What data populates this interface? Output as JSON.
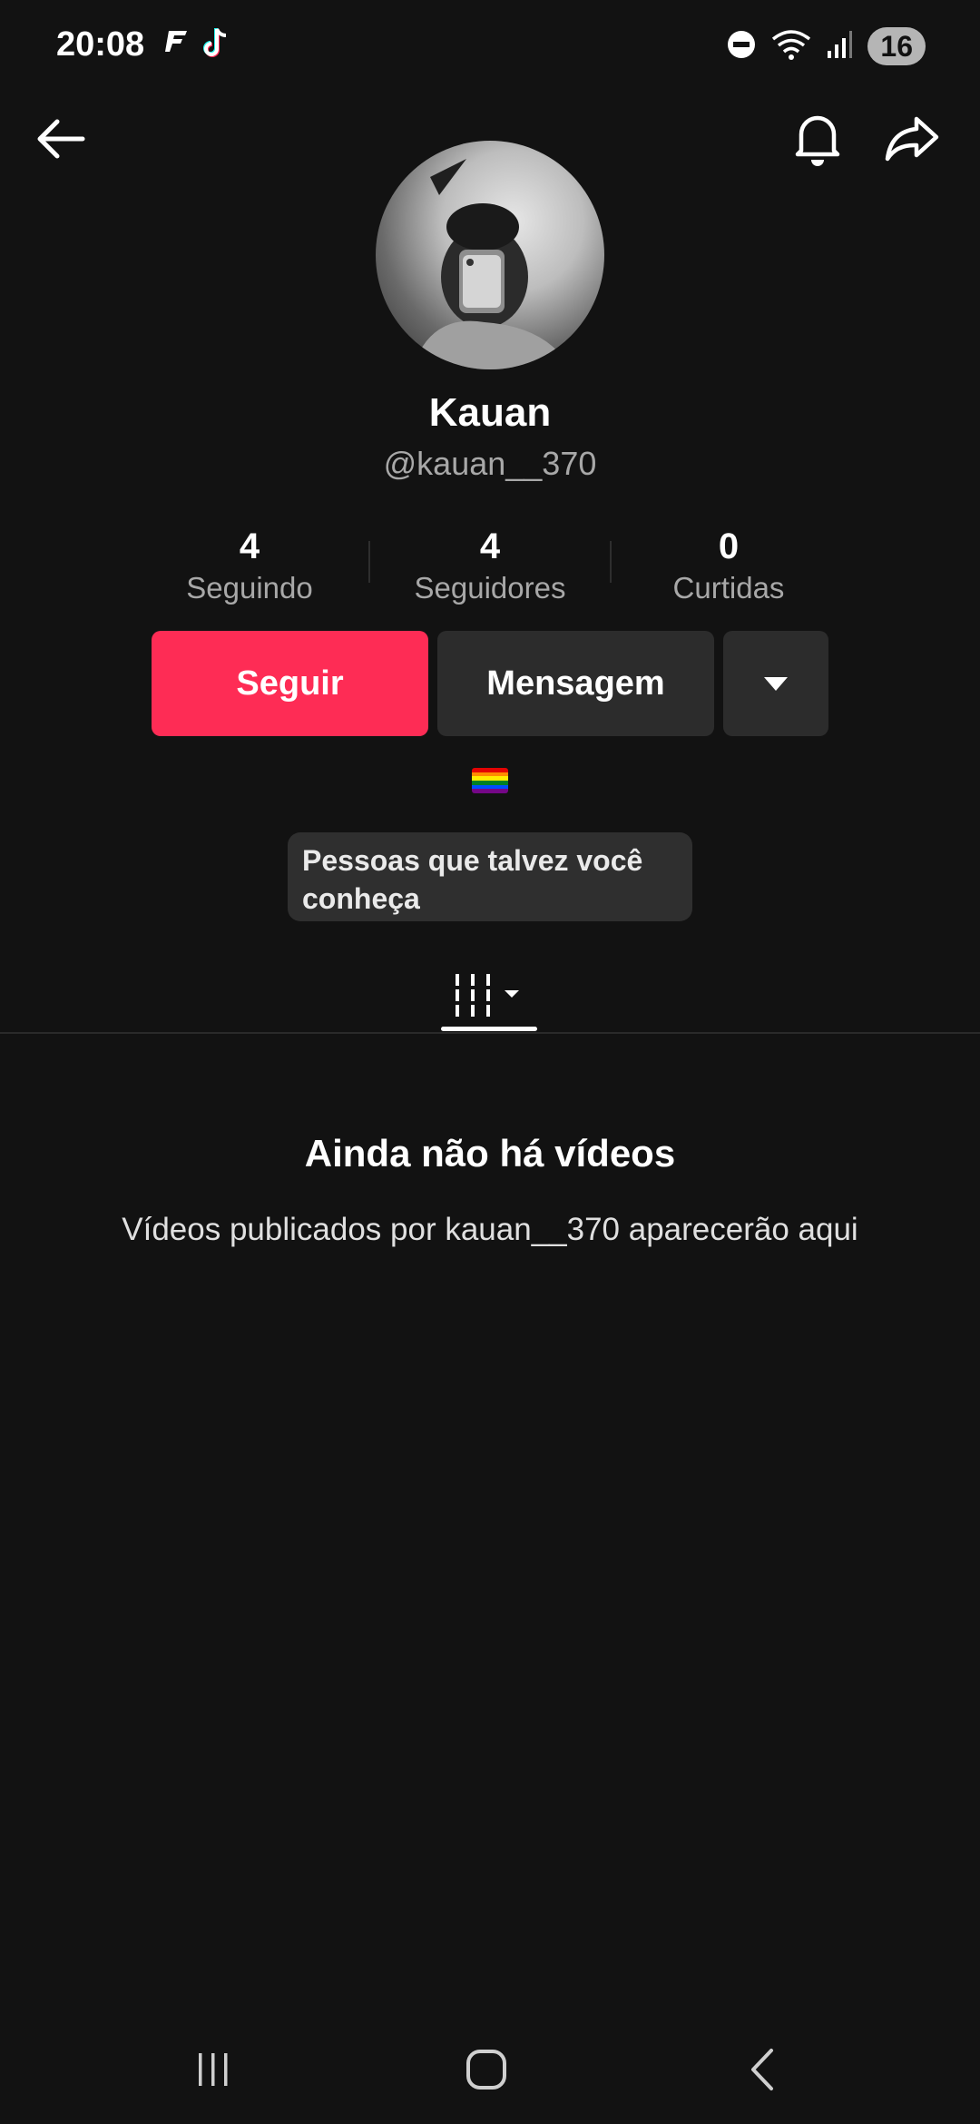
{
  "status_bar": {
    "time": "20:08",
    "battery": "16",
    "icons": [
      "flash-icon",
      "tiktok-icon",
      "dnd-icon",
      "wifi-icon",
      "signal-icon",
      "battery-icon"
    ]
  },
  "header": {
    "back_icon": "arrow-left-icon",
    "bell_icon": "bell-icon",
    "share_icon": "share-icon"
  },
  "profile": {
    "display_name": "Kauan",
    "username": "@kauan__370",
    "stats": [
      {
        "value": "4",
        "label": "Seguindo"
      },
      {
        "value": "4",
        "label": "Seguidores"
      },
      {
        "value": "0",
        "label": "Curtidas"
      }
    ],
    "bio_flag": "rainbow-flag"
  },
  "actions": {
    "follow_label": "Seguir",
    "message_label": "Mensagem",
    "more_icon": "caret-down-icon",
    "suggestion_label": "Pessoas que talvez você conheça"
  },
  "tab": {
    "icon": "grid-icon"
  },
  "empty_state": {
    "title": "Ainda não há vídeos",
    "subtitle": "Vídeos publicados por kauan__370 aparecerão aqui"
  },
  "colors": {
    "background": "#121212",
    "accent": "#fe2c55",
    "button_dark": "#2c2c2c",
    "muted_text": "#a8a8a8"
  }
}
